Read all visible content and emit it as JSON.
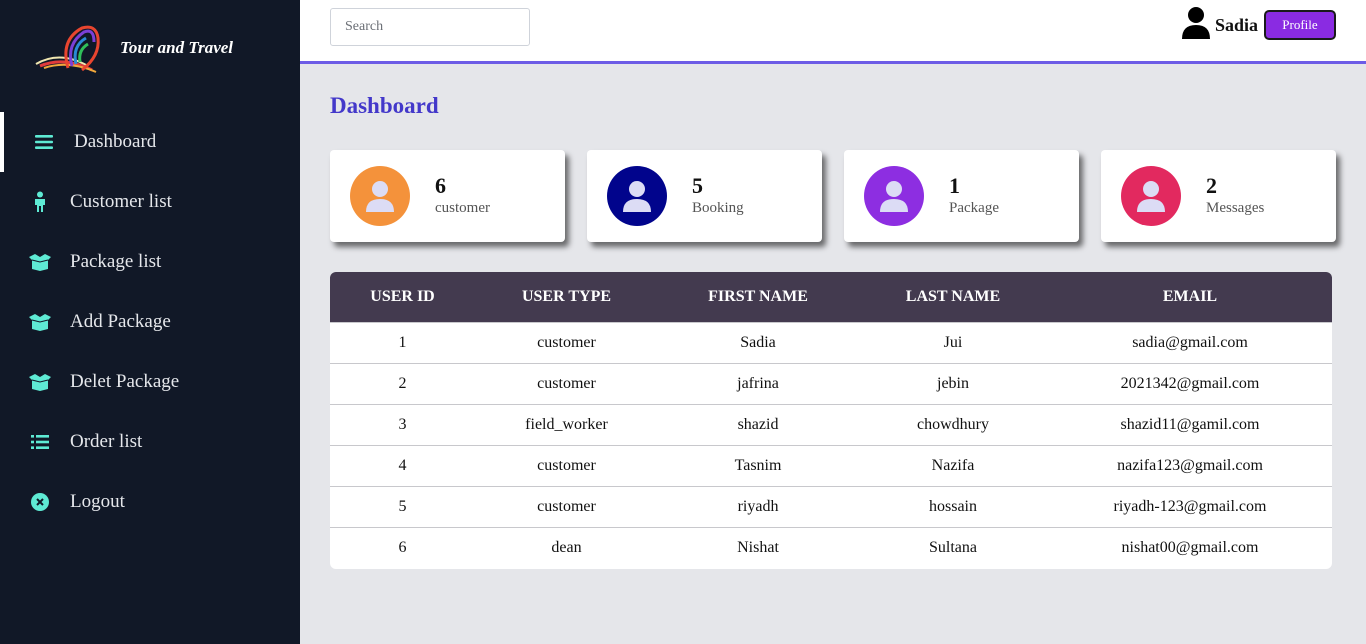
{
  "brand": {
    "name": "Tour and Travel"
  },
  "sidebar": {
    "items": [
      {
        "label": "Dashboard",
        "icon": "hamburger-icon"
      },
      {
        "label": "Customer list",
        "icon": "person-icon"
      },
      {
        "label": "Package list",
        "icon": "box-icon"
      },
      {
        "label": "Add Package",
        "icon": "box-icon"
      },
      {
        "label": "Delet Package",
        "icon": "box-icon"
      },
      {
        "label": "Order list",
        "icon": "list-icon"
      },
      {
        "label": "Logout",
        "icon": "close-circle-icon"
      }
    ],
    "accent_color": "#5eead4"
  },
  "header": {
    "search_placeholder": "Search",
    "user_name": "Sadia",
    "profile_label": "Profile"
  },
  "page": {
    "title": "Dashboard"
  },
  "cards": [
    {
      "value": "6",
      "label": "customer",
      "color": "#f4923b"
    },
    {
      "value": "5",
      "label": "Booking",
      "color": "#01048c"
    },
    {
      "value": "1",
      "label": "Package",
      "color": "#8d2ee1"
    },
    {
      "value": "2",
      "label": "Messages",
      "color": "#e2295f"
    }
  ],
  "table": {
    "columns": [
      "USER ID",
      "USER TYPE",
      "FIRST NAME",
      "LAST NAME",
      "EMAIL"
    ],
    "rows": [
      [
        "1",
        "customer",
        "Sadia",
        "Jui",
        "sadia@gmail.com"
      ],
      [
        "2",
        "customer",
        "jafrina",
        "jebin",
        "2021342@gmail.com"
      ],
      [
        "3",
        "field_worker",
        "shazid",
        "chowdhury",
        "shazid11@gamil.com"
      ],
      [
        "4",
        "customer",
        "Tasnim",
        "Nazifa",
        "nazifa123@gmail.com"
      ],
      [
        "5",
        "customer",
        "riyadh",
        "hossain",
        "riyadh-123@gmail.com"
      ],
      [
        "6",
        "dean",
        "Nishat",
        "Sultana",
        "nishat00@gmail.com"
      ]
    ]
  }
}
